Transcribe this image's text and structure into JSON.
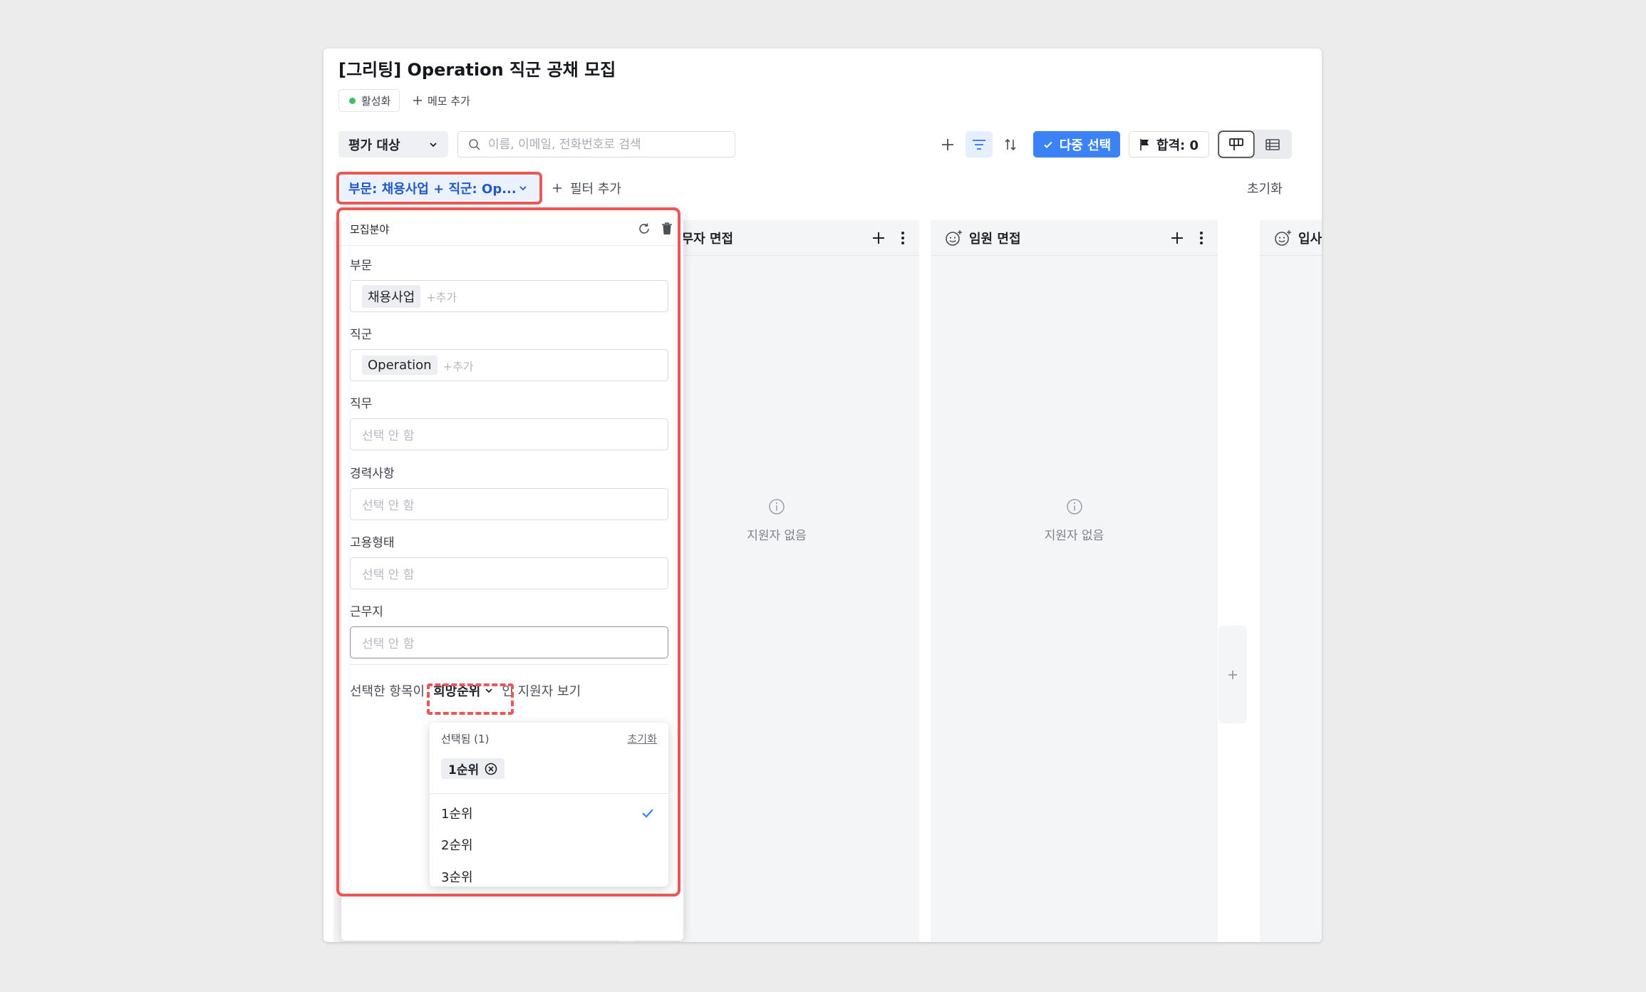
{
  "page": {
    "title": "[그리팅] Operation 직군 공채 모집"
  },
  "status": {
    "label": "활성화",
    "color": "#3ac25f"
  },
  "memo": {
    "label": "메모 추가"
  },
  "toolbar": {
    "eval_select": "평가 대상",
    "search_placeholder": "이름, 이메일, 전화번호로 검색",
    "multi_select_label": "다중 선택",
    "pass_label": "합격: 0",
    "accent_color": "#3b82f6"
  },
  "filter_bar": {
    "active_filter": "부문: 채용사업 + 직군: Op...",
    "add_filter_label": "필터 추가",
    "reset_label": "초기화"
  },
  "columns": [
    {
      "title": "실무자 면접",
      "icon": "smile-icon",
      "empty_text": "지원자 없음"
    },
    {
      "title": "임원 면접",
      "icon": "smile-icon",
      "empty_text": "지원자 없음"
    },
    {
      "title": "입사",
      "icon": "smile-icon"
    }
  ],
  "filter_panel": {
    "title": "모집분야",
    "fields": [
      {
        "label": "부문",
        "tag": "채용사업",
        "add_hint": "+추가"
      },
      {
        "label": "직군",
        "tag": "Operation",
        "add_hint": "+추가"
      },
      {
        "label": "직무",
        "placeholder": "선택 안 함"
      },
      {
        "label": "경력사항",
        "placeholder": "선택 안 함"
      },
      {
        "label": "고용형태",
        "placeholder": "선택 안 함"
      },
      {
        "label": "근무지",
        "placeholder": "선택 안 함"
      }
    ],
    "applicant_prefix": "선택한 항목이",
    "rank_select": "희망순위",
    "applicant_suffix": "인 지원자 보기"
  },
  "rank_dropdown": {
    "selected_header": "선택됨 (1)",
    "reset_label": "초기화",
    "selected_chip": "1순위",
    "options": [
      {
        "label": "1순위",
        "checked": true
      },
      {
        "label": "2순위",
        "checked": false
      },
      {
        "label": "3순위",
        "checked": false
      }
    ]
  }
}
